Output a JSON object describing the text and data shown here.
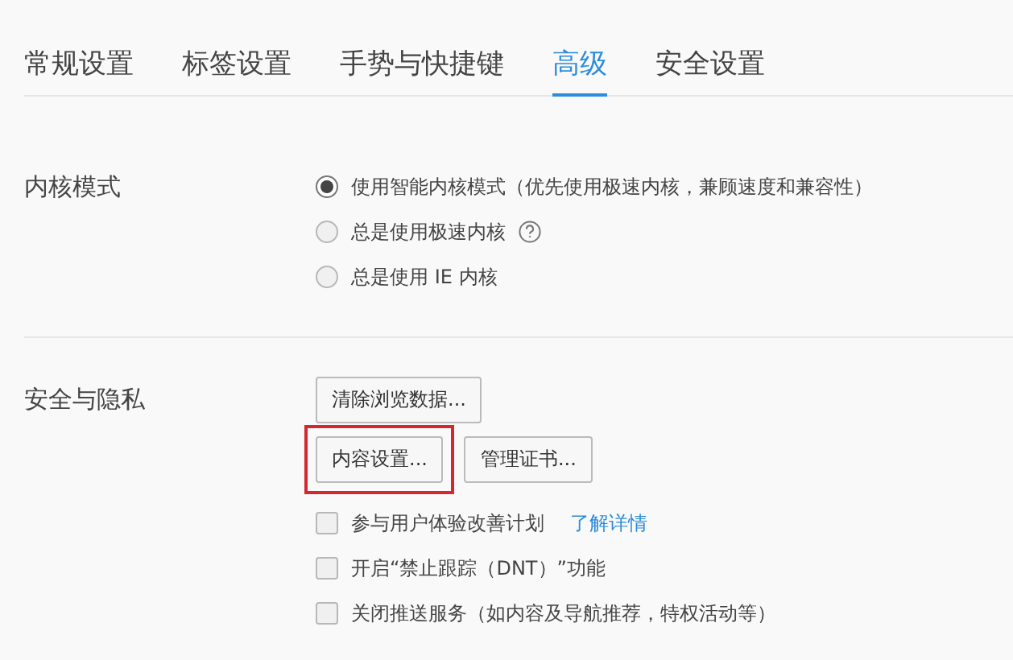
{
  "tabs": [
    {
      "label": "常规设置",
      "selected": false
    },
    {
      "label": "标签设置",
      "selected": false
    },
    {
      "label": "手势与快捷键",
      "selected": false
    },
    {
      "label": "高级",
      "selected": true
    },
    {
      "label": "安全设置",
      "selected": false
    }
  ],
  "sections": [
    {
      "title": "内核模式",
      "radios": [
        {
          "label": "使用智能内核模式（优先使用极速内核，兼顾速度和兼容性）",
          "selected": true,
          "help": false
        },
        {
          "label": "总是使用极速内核",
          "selected": false,
          "help": true
        },
        {
          "label": "总是使用 IE 内核",
          "selected": false,
          "help": false
        }
      ]
    },
    {
      "title": "安全与隐私",
      "button_rows": [
        [
          {
            "label": "清除浏览数据...",
            "highlighted": false
          }
        ],
        [
          {
            "label": "内容设置...",
            "highlighted": true
          },
          {
            "label": "管理证书...",
            "highlighted": false
          }
        ]
      ],
      "checkboxes": [
        {
          "label": "参与用户体验改善计划",
          "checked": false,
          "link": "了解详情"
        },
        {
          "label": "开启“禁止跟踪（DNT）”功能",
          "checked": false
        },
        {
          "label": "关闭推送服务（如内容及导航推荐，特权活动等）",
          "checked": false
        }
      ]
    }
  ]
}
